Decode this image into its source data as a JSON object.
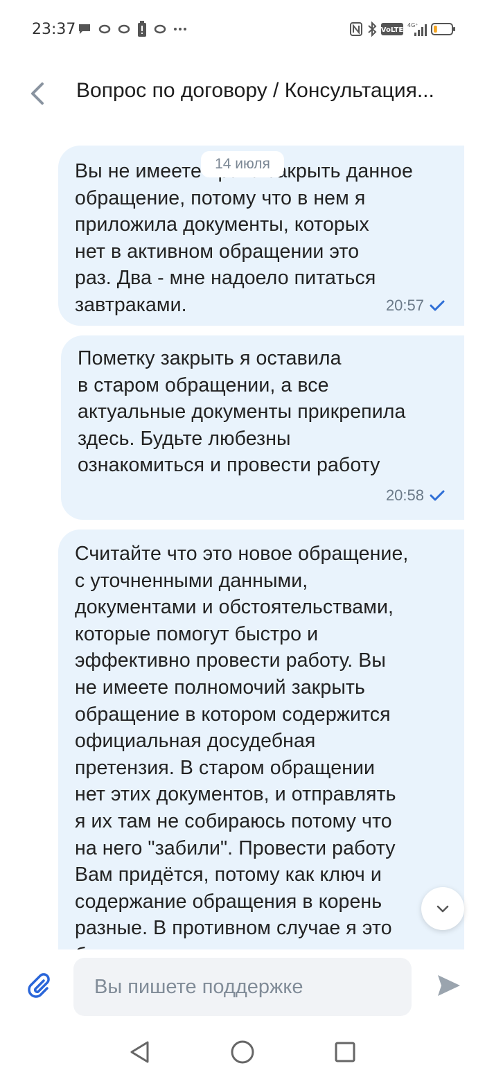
{
  "status_bar": {
    "time": "23:37",
    "network": "4G⁺",
    "volte": "VoLTE",
    "battery_level": 0.2,
    "battery_color": "#f5a623"
  },
  "header": {
    "title": "Вопрос по договору / Консультация...",
    "back_icon": "chevron-left-icon"
  },
  "chat": {
    "date_chip": "14 июля",
    "messages": [
      {
        "lines": [
          "Вы не имеете права закрыть данное",
          "обращение, потому что в нем я",
          "приложила документы, которых",
          "нет в активном обращении это",
          "раз. Два - мне надоело питаться",
          "завтраками."
        ],
        "time": "20:57",
        "status": "sent"
      },
      {
        "lines": [
          "Пометку закрыть я оставила",
          "в старом обращении, а все",
          "актуальные документы прикрепила",
          "здесь. Будьте любезны",
          "ознакомиться и провести работу"
        ],
        "time": "20:58",
        "status": "sent"
      },
      {
        "lines": [
          "Считайте что это новое обращение,",
          "с уточненными данными,",
          "документами и обстоятельствами,",
          "которые помогут быстро и",
          "эффективно провести работу. Вы",
          "не имеете полномочий закрыть",
          "обращение в котором содержится",
          "официальная досудебная",
          "претензия. В старом обращении",
          "нет этих документов, и отправлять",
          "я их там не собираюсь потому что",
          "на него \"забили\". Провести работу",
          "Вам придётся, потому как ключ и",
          "содержание обращения в корень",
          "разные. В противном случае я это",
          "буду расценивать как намеренное"
        ]
      }
    ],
    "bubble_color": "#e9f3fc",
    "check_color": "#2f6fd6"
  },
  "input": {
    "placeholder": "Вы пишете поддержке",
    "accent_color": "#2a66d9"
  }
}
